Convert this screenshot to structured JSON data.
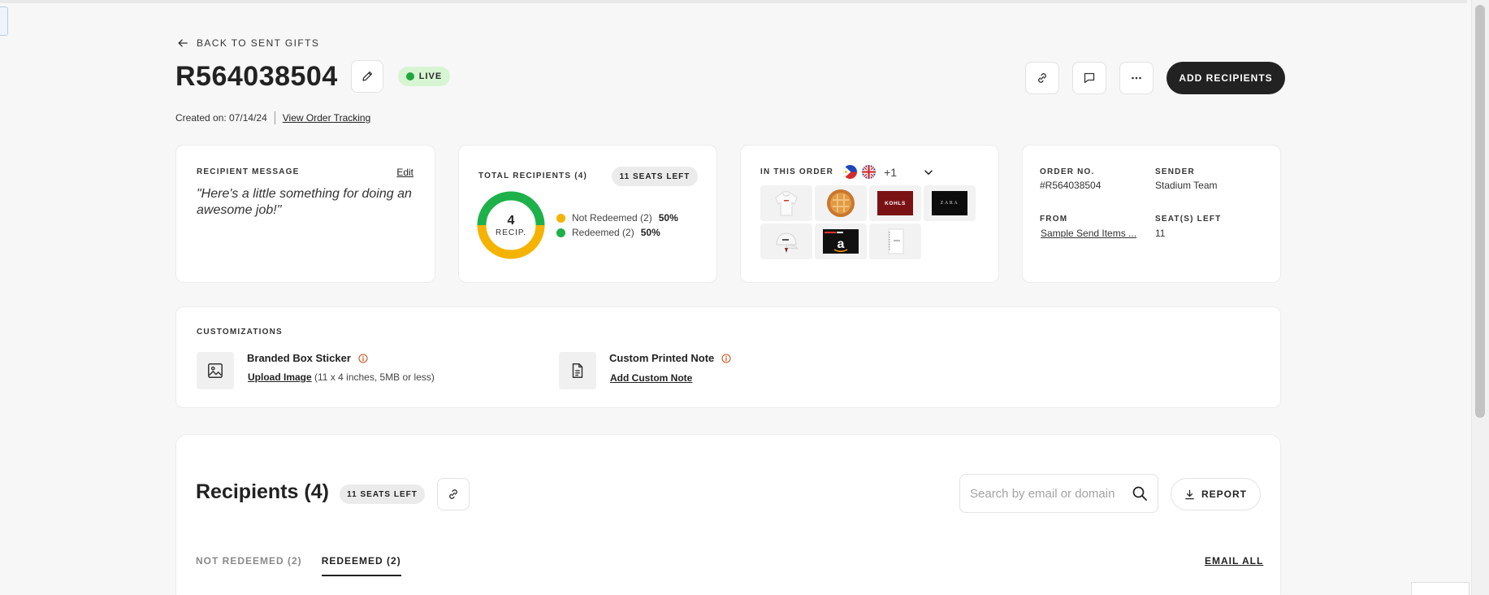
{
  "header": {
    "back_label": "BACK TO SENT GIFTS",
    "order_title": "R564038504",
    "status": "LIVE",
    "created_text": "Created on: 07/14/24",
    "tracking_link": "View Order Tracking",
    "add_recipients_label": "ADD RECIPIENTS"
  },
  "recipient_message": {
    "label": "RECIPIENT MESSAGE",
    "edit_label": "Edit",
    "message": "\"Here's a little something for doing an awesome job!\""
  },
  "total_recipients": {
    "label": "TOTAL RECIPIENTS (4)",
    "seats_badge": "11 SEATS LEFT",
    "center_value": "4",
    "center_label": "RECIP.",
    "legend": [
      {
        "label": "Not Redeemed (2)",
        "percent": "50%",
        "color": "#f5b301",
        "fraction": 0.5
      },
      {
        "label": "Redeemed (2)",
        "percent": "50%",
        "color": "#1eb14a",
        "fraction": 0.5
      }
    ]
  },
  "in_this_order": {
    "label": "IN THIS ORDER",
    "extra_count": "+1",
    "products": [
      {
        "icon": "hoodie-icon"
      },
      {
        "icon": "pie-icon"
      },
      {
        "icon": "kohls-gift-card-icon",
        "brand_text": "KOHLS"
      },
      {
        "icon": "zara-gift-card-icon",
        "brand_text": "ZARA"
      },
      {
        "icon": "cap-icon"
      },
      {
        "icon": "amazon-gift-card-icon"
      },
      {
        "icon": "notebook-icon"
      }
    ]
  },
  "order_info": {
    "order_no_label": "ORDER NO.",
    "order_no": "#R564038504",
    "sender_label": "SENDER",
    "sender": "Stadium Team",
    "from_label": "FROM",
    "from": "Sample Send Items ...",
    "seats_label": "SEAT(S) LEFT",
    "seats": "11"
  },
  "customizations": {
    "label": "CUSTOMIZATIONS",
    "sticker_title": "Branded Box Sticker",
    "sticker_link": "Upload Image",
    "sticker_hint": "(11 x 4 inches, 5MB or less)",
    "note_title": "Custom Printed Note",
    "note_link": "Add Custom Note"
  },
  "recipients": {
    "title": "Recipients (4)",
    "seats_badge": "11 SEATS LEFT",
    "search_placeholder": "Search by email or domain",
    "report_label": "REPORT",
    "tabs": [
      {
        "label": "NOT REDEEMED (2)",
        "active": false
      },
      {
        "label": "REDEEMED (2)",
        "active": true
      }
    ],
    "email_all_label": "EMAIL ALL"
  }
}
